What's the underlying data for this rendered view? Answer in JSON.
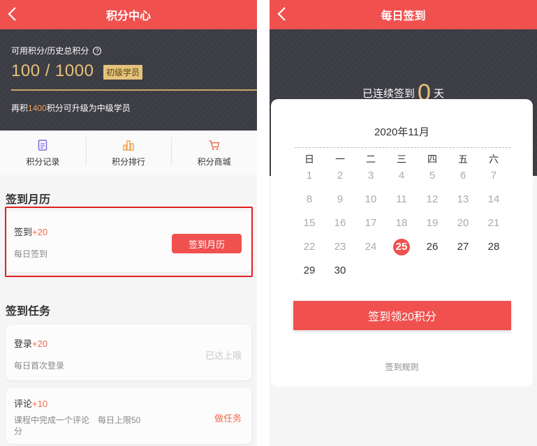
{
  "left": {
    "title": "积分中心",
    "points_label": "可用积分/历史总积分",
    "help_glyph": "?",
    "points_value": "100 / 1000",
    "level_badge": "初级学员",
    "upgrade_prefix": "再积",
    "upgrade_amount": "1400",
    "upgrade_suffix": "积分可升级为中级学员",
    "shortcuts": [
      {
        "label": "积分记录",
        "icon": "document-icon",
        "color": "#7b6ae0"
      },
      {
        "label": "积分排行",
        "icon": "bar-chart-icon",
        "color": "#f0a04a"
      },
      {
        "label": "积分商城",
        "icon": "cart-icon",
        "color": "#f06a4d"
      }
    ],
    "checkin_section_title": "签到月历",
    "checkin_card": {
      "name": "签到",
      "points": "+20",
      "desc": "每日签到",
      "button": "签到月历"
    },
    "tasks_section_title": "签到任务",
    "tasks": [
      {
        "name": "登录",
        "points": "+20",
        "desc": "每日首次登录",
        "status": "已达上限",
        "status_color": "#c8c8c8"
      },
      {
        "name": "评论",
        "points": "+10",
        "desc": "课程中完成一个评论　每日上限50分",
        "status": "做任务",
        "status_color": "#f06a4d"
      }
    ]
  },
  "right": {
    "title": "每日签到",
    "streak_prefix": "已连续签到",
    "streak_count": "0",
    "streak_suffix": "天",
    "calendar": {
      "month": "2020年11月",
      "weekdays": [
        "日",
        "一",
        "二",
        "三",
        "四",
        "五",
        "六"
      ],
      "first_weekday": 0,
      "days_in_month": 30,
      "today": 25
    },
    "sign_button": "签到领20积分",
    "rules_link": "签到规则"
  },
  "colors": {
    "accent": "#f0514f",
    "gold": "#e8c27a",
    "dark_header": "#3c3c44"
  }
}
